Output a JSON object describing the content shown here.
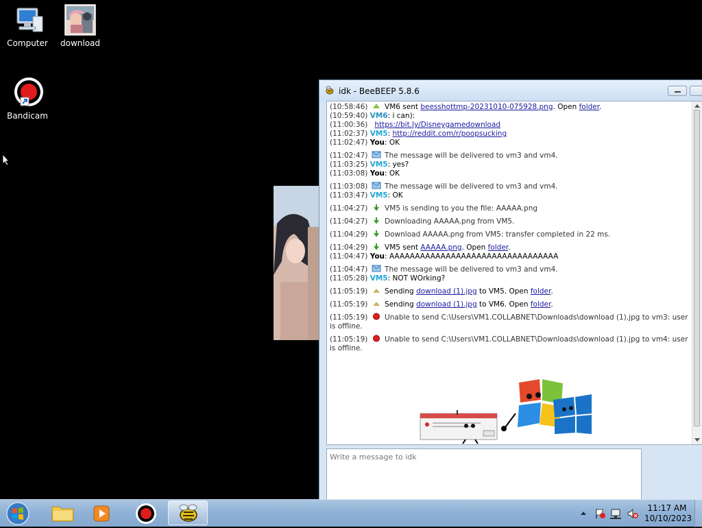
{
  "desktop": {
    "icons": [
      {
        "label": "Computer"
      },
      {
        "label": "download"
      },
      {
        "label": "Bandicam"
      }
    ]
  },
  "window": {
    "title": "idk - BeeBEEP 5.8.6"
  },
  "chat": {
    "m0": {
      "time": "(10:58:46)",
      "pre": " VM6 sent ",
      "link": "beesshottmp-20231010-075928.png",
      "mid": ". Open ",
      "link2": "folder",
      "post": "."
    },
    "m1": {
      "time": "(10:59:40)",
      "user": "VM6",
      "text": ": i can):"
    },
    "m2": {
      "time": "(11:00:36)",
      "link": "https://bit.ly/Disneygamedownload"
    },
    "m3": {
      "time": "(11:02:37)",
      "user": "VM5",
      "sep": ": ",
      "link": "http://reddit.com/r/poopsucking"
    },
    "m4": {
      "time": "(11:02:47)",
      "user": "You",
      "text": ": OK"
    },
    "m5": {
      "time": "(11:02:47)",
      "text": " The message will be delivered to vm3 and vm4."
    },
    "m6": {
      "time": "(11:03:25)",
      "user": "VM5",
      "text": ": yes?"
    },
    "m7": {
      "time": "(11:03:08)",
      "user": "You",
      "text": ": OK"
    },
    "m8": {
      "time": "(11:03:08)",
      "text": " The message will be delivered to vm3 and vm4."
    },
    "m9": {
      "time": "(11:03:47)",
      "user": "VM5",
      "text": ": OK"
    },
    "m10": {
      "time": "(11:04:27)",
      "text": " VM5 is sending to you the file: AAAAA.png"
    },
    "m11": {
      "time": "(11:04:27)",
      "text": " Downloading AAAAA.png from VM5."
    },
    "m12": {
      "time": "(11:04:29)",
      "text": " Download AAAAA.png from VM5: transfer completed in 22 ms."
    },
    "m13": {
      "time": "(11:04:29)",
      "pre": " VM5 sent ",
      "link": "AAAAA.png",
      "mid": ". Open ",
      "link2": "folder",
      "post": "."
    },
    "m14": {
      "time": "(11:04:47)",
      "user": "You",
      "text": ": AAAAAAAAAAAAAAAAAAAAAAAAAAAAAAAAA"
    },
    "m15": {
      "time": "(11:04:47)",
      "text": " The message will be delivered to vm3 and vm4."
    },
    "m16": {
      "time": "(11:05:28)",
      "user": "VM5",
      "text": ": NOT WOrking?"
    },
    "m17": {
      "time": "(11:05:19)",
      "pre": " Sending ",
      "link": "download (1).jpg",
      "mid": " to VM5. Open ",
      "link2": "folder",
      "post": "."
    },
    "m18": {
      "time": "(11:05:19)",
      "pre": " Sending ",
      "link": "download (1).jpg",
      "mid": " to VM6. Open ",
      "link2": "folder",
      "post": "."
    },
    "m19": {
      "time": "(11:05:19)",
      "text": " Unable to send C:\\Users\\VM1.COLLABNET\\Downloads\\download (1).jpg to vm3: user is offline."
    },
    "m20": {
      "time": "(11:05:19)",
      "text": " Unable to send C:\\Users\\VM1.COLLABNET\\Downloads\\download (1).jpg to vm4: user is offline."
    }
  },
  "composer": {
    "placeholder": "Write a message to idk"
  },
  "taskbar": {
    "time": "11:17 AM",
    "date": "10/10/2023"
  },
  "colors": {
    "vm5": "#1fa6d9",
    "link": "#1a1aa0",
    "taskbar": "#8fb1d6"
  }
}
